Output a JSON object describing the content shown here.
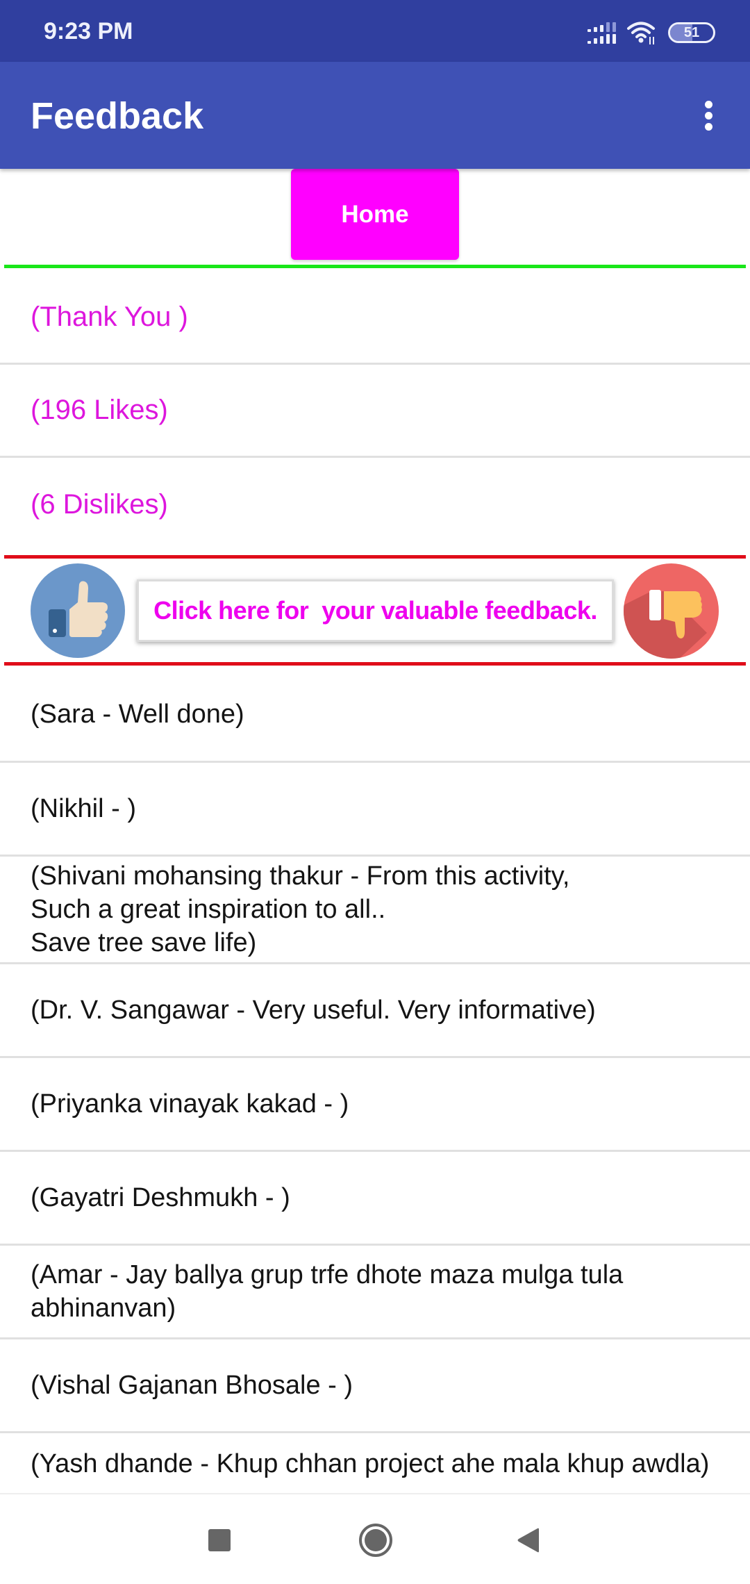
{
  "status_bar": {
    "time": "9:23 PM",
    "battery_level": "51",
    "battery_fraction": 0.51,
    "icons": [
      "signal-icon",
      "wifi-icon",
      "battery-icon"
    ]
  },
  "app_bar": {
    "title": "Feedback",
    "overflow_icon": "more-vert-icon",
    "color": "#3f51b5",
    "status_color": "#303f9f"
  },
  "home_button": {
    "label": "Home",
    "color": "#ff00ff"
  },
  "stats": [
    {
      "label": "(Thank You )"
    },
    {
      "label": "(196 Likes)"
    },
    {
      "label": "(6 Dislikes)"
    }
  ],
  "feedback_banner": {
    "text": "Click here for  your valuable feedback.",
    "like_icon": "thumbs-up-icon",
    "dislike_icon": "thumbs-down-icon",
    "text_color": "#ee00ee"
  },
  "comments": [
    {
      "text": "(Sara - Well done)"
    },
    {
      "text": "(Nikhil - )"
    },
    {
      "text": "(Shivani mohansing thakur - From this activity,\nSuch a great inspiration to all..\nSave tree save life)"
    },
    {
      "text": "(Dr. V. Sangawar - Very useful. Very informative)"
    },
    {
      "text": "(Priyanka vinayak kakad - )"
    },
    {
      "text": "(Gayatri Deshmukh - )"
    },
    {
      "text": "(Amar - Jay ballya grup trfe dhote maza mulga tula abhinanvan)"
    },
    {
      "text": "(Vishal Gajanan Bhosale - )"
    },
    {
      "text": "(Yash dhande - Khup chhan project ahe mala khup awdla)"
    }
  ],
  "nav_bar": {
    "buttons": [
      "recents-icon",
      "home-icon",
      "back-icon"
    ]
  }
}
